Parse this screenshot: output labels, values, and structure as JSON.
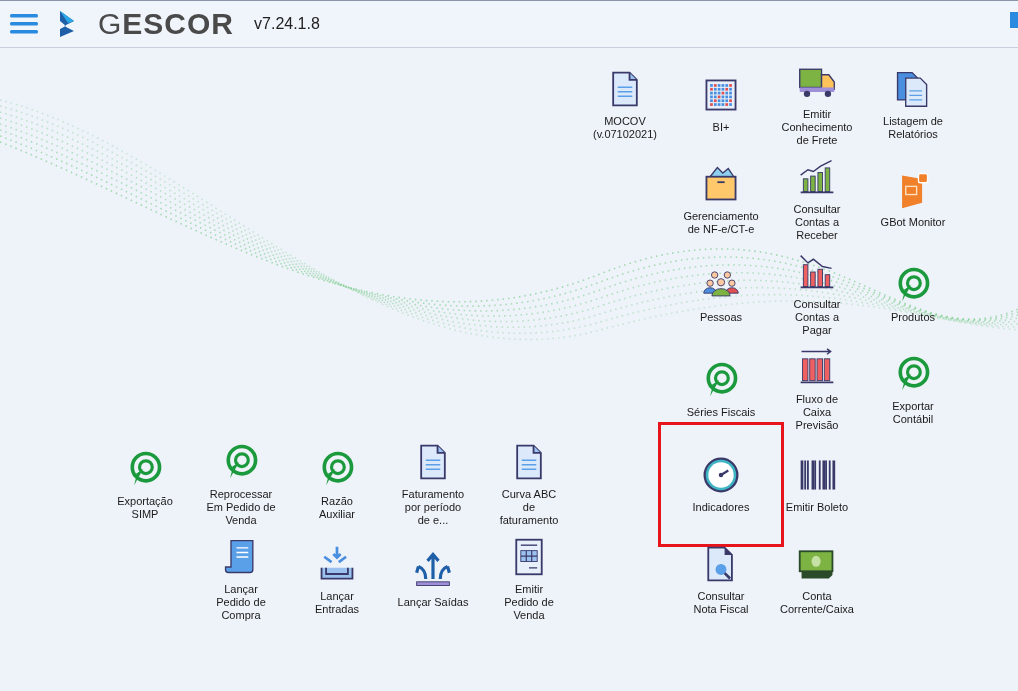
{
  "header": {
    "logo": "G**ESCOR**",
    "version": "v7.24.1.8"
  },
  "shortcuts": [
    {
      "label": "MOCOV\n(v.07102021)",
      "kind": "document",
      "selected": false
    },
    {
      "label": "BI+",
      "kind": "grid",
      "selected": false
    },
    {
      "label": "Emitir\nConhecimento\nde Frete",
      "kind": "truck",
      "selected": false
    },
    {
      "label": "Listagem de\nRelatórios",
      "kind": "documents",
      "selected": false
    },
    {
      "label": "Gerenciamento\nde NF-e/CT-e",
      "kind": "box",
      "selected": false
    },
    {
      "label": "Consultar\nContas a\nReceber",
      "kind": "chart-up",
      "selected": false
    },
    {
      "label": "GBot Monitor",
      "kind": "chat-badge",
      "selected": false
    },
    {
      "label": "Pessoas",
      "kind": "people",
      "selected": false
    },
    {
      "label": "Consultar\nContas a\nPagar",
      "kind": "chart-down",
      "selected": false
    },
    {
      "label": "Produtos",
      "kind": "target",
      "selected": false
    },
    {
      "label": "Séries Fiscais",
      "kind": "target",
      "selected": false
    },
    {
      "label": "Fluxo de\nCaixa\nPrevisão",
      "kind": "bar-arrow",
      "selected": false
    },
    {
      "label": "Exportar\nContábil",
      "kind": "target",
      "selected": false
    },
    {
      "label": "Exportação\nSIMP",
      "kind": "target",
      "selected": false
    },
    {
      "label": "Reprocessar\nEm Pedido de\nVenda",
      "kind": "target",
      "selected": false
    },
    {
      "label": "Razão\nAuxiliar",
      "kind": "target",
      "selected": false
    },
    {
      "label": "Faturamento\npor período\nde e...",
      "kind": "document",
      "selected": false
    },
    {
      "label": "Curva ABC\nde\nfaturamento",
      "kind": "document",
      "selected": false
    },
    {
      "label": "Indicadores",
      "kind": "gauge",
      "selected": true
    },
    {
      "label": "Emitir Boleto",
      "kind": "barcode",
      "selected": false
    },
    {
      "label": "Lançar\nPedido de\nCompra",
      "kind": "scroll",
      "selected": false
    },
    {
      "label": "Lançar\nEntradas",
      "kind": "tray-in",
      "selected": false
    },
    {
      "label": "Lançar Saídas",
      "kind": "arrows-out",
      "selected": false
    },
    {
      "label": "Emitir\nPedido de\nVenda",
      "kind": "form",
      "selected": false
    },
    {
      "label": "Consultar\nNota Fiscal",
      "kind": "search-doc",
      "selected": false
    },
    {
      "label": "Conta\nCorrente/Caixa",
      "kind": "banknote",
      "selected": false
    }
  ]
}
